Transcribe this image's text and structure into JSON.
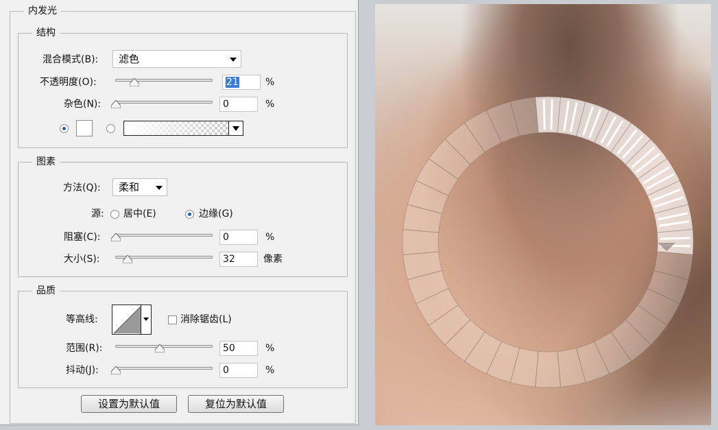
{
  "inner_glow": {
    "title": "内发光",
    "structure": {
      "title": "结构",
      "blend_mode_label": "混合模式(B):",
      "blend_mode_value": "滤色",
      "opacity_label": "不透明度(O):",
      "opacity_value": "21",
      "opacity_level": 0.21,
      "opacity_unit": "%",
      "noise_label": "杂色(N):",
      "noise_value": "0",
      "noise_level": 0,
      "noise_unit": "%"
    },
    "elements": {
      "title": "图素",
      "technique_label": "方法(Q):",
      "technique_value": "柔和",
      "source_label": "源:",
      "source_center": "居中(E)",
      "source_edge": "边缘(G)",
      "choke_label": "阻塞(C):",
      "choke_value": "0",
      "choke_level": 0,
      "choke_unit": "%",
      "size_label": "大小(S):",
      "size_value": "32",
      "size_level": 0.13,
      "size_unit": "像素"
    },
    "quality": {
      "title": "品质",
      "contour_label": "等高线:",
      "antialias_label": "消除锯齿(L)",
      "range_label": "范围(R):",
      "range_value": "50",
      "range_level": 0.5,
      "range_unit": "%",
      "jitter_label": "抖动(J):",
      "jitter_value": "0",
      "jitter_level": 0,
      "jitter_unit": "%"
    },
    "buttons": {
      "make_default": "设置为默认值",
      "reset_default": "复位为默认值"
    }
  },
  "colors": {
    "panel_bg": "#f0f0f0",
    "selection": "#3a7bd5",
    "radio_dot": "#1e5fb8"
  },
  "preview": {
    "ring_segments": 36,
    "highlighted_segments": 10
  }
}
